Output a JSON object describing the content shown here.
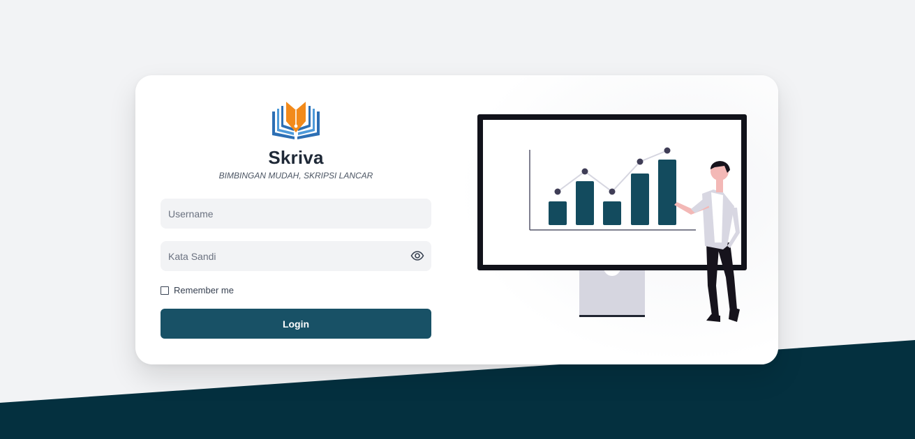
{
  "brand": {
    "name": "Skriva",
    "tagline": "BIMBINGAN MUDAH, SKRIPSI LANCAR"
  },
  "form": {
    "username_placeholder": "Username",
    "password_placeholder": "Kata Sandi",
    "remember_label": "Remember me",
    "login_label": "Login"
  },
  "icons": {
    "logo": "book-pen-logo-icon",
    "password_toggle": "eye-icon",
    "illustration": "presentation-chart-illustration"
  },
  "colors": {
    "primary": "#185166",
    "background_wave": "#04303f",
    "logo_orange": "#f28a1b",
    "logo_blue": "#2d6fb4",
    "page_bg": "#f2f3f5"
  }
}
